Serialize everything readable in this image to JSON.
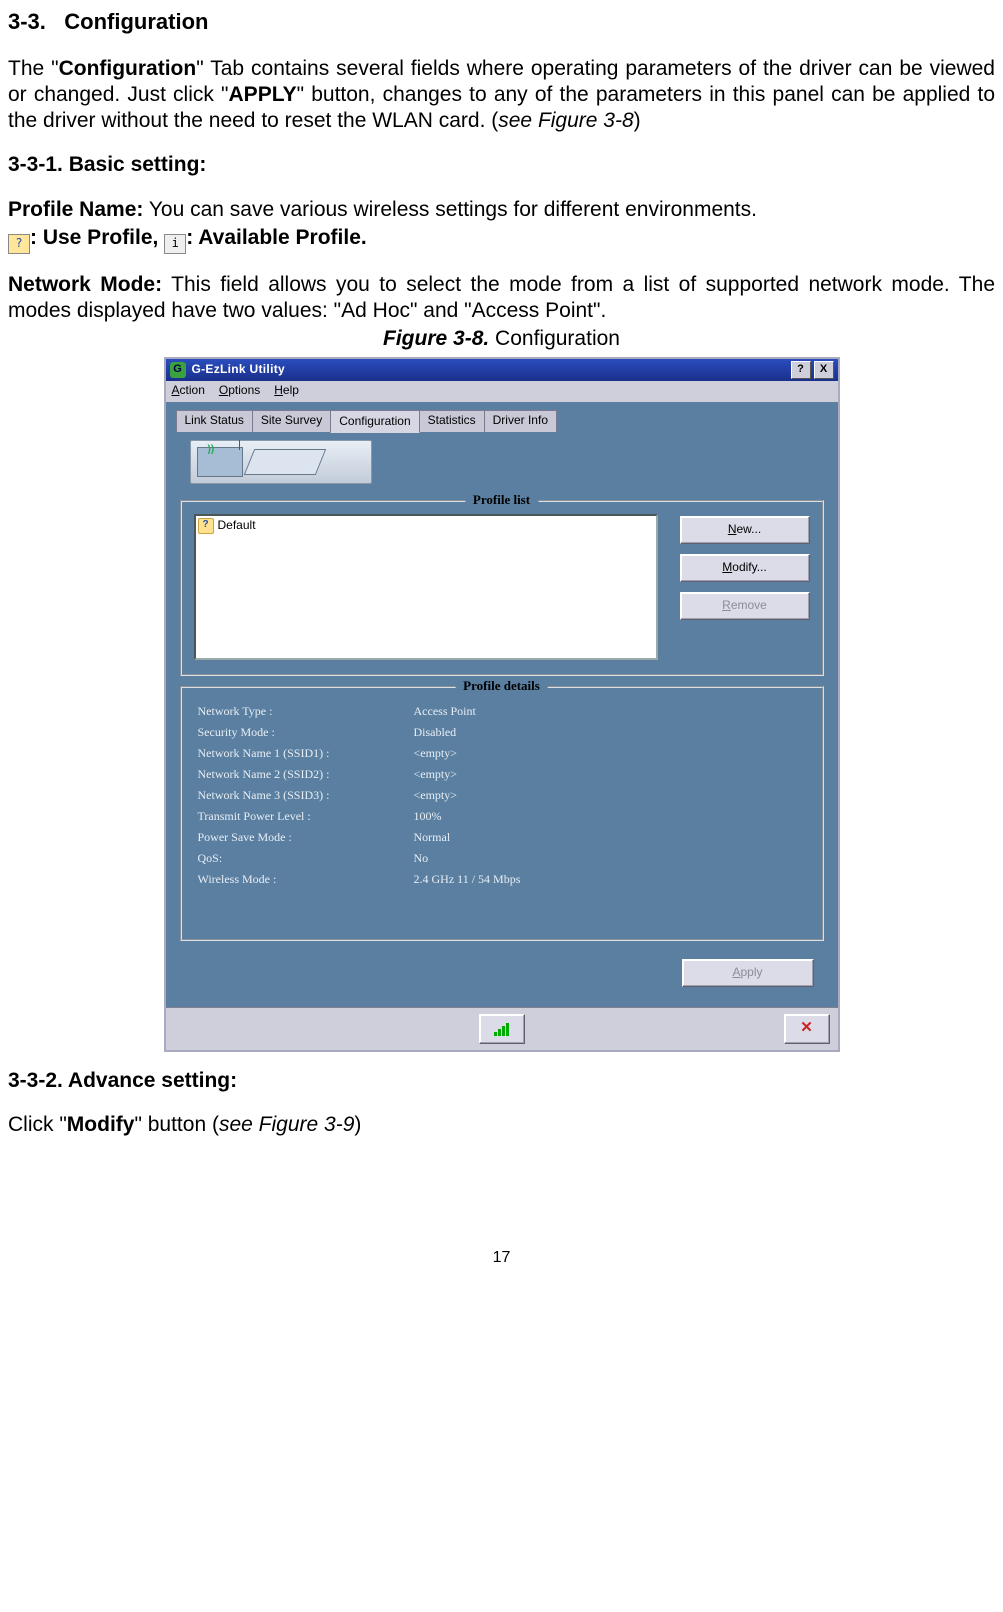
{
  "doc": {
    "section_no": "3-3.",
    "section_title": "Configuration",
    "p1_a": "The \"",
    "p1_b": "Configuration",
    "p1_c": "\" Tab contains several fields where operating parameters of the driver can be viewed or changed. Just click \"",
    "p1_d": "APPLY",
    "p1_e": "\" button, changes to any of the parameters in this panel can be applied to the driver without the need to reset the WLAN card. (",
    "p1_f": "see Figure 3-8",
    "p1_g": ")",
    "h331": "3-3-1. Basic setting:",
    "pn_label": "Profile Name:",
    "pn_text": " You can save various wireless settings for different environments.",
    "pn_use": ": Use Profile, ",
    "pn_avail": ": Available Profile.",
    "nm_label": "Network Mode:",
    "nm_text": " This field allows you to select the mode from a list of supported network mode. The modes displayed have two values: \"Ad Hoc\" and \"Access Point\".",
    "fig_label": "Figure 3-8.",
    "fig_text": "   Configuration",
    "h332": "3-3-2. Advance setting:",
    "p2_a": "Click \"",
    "p2_b": "Modify",
    "p2_c": "\" button (",
    "p2_d": "see Figure 3-9",
    "p2_e": ")",
    "page_num": "17"
  },
  "app": {
    "title": "G-EzLink Utility",
    "help_glyph": "?",
    "close_glyph": "X",
    "menu": {
      "action": "Action",
      "options": "Options",
      "help": "Help"
    },
    "tabs": {
      "link_status": "Link Status",
      "site_survey": "Site Survey",
      "configuration": "Configuration",
      "statistics": "Statistics",
      "driver_info": "Driver Info"
    },
    "profile_list_title": "Profile list",
    "profile_item": "Default",
    "btn_new": "New...",
    "btn_modify": "Modify...",
    "btn_remove": "Remove",
    "profile_details_title": "Profile details",
    "details": {
      "network_type_l": "Network Type :",
      "network_type_v": "Access Point",
      "security_mode_l": "Security Mode :",
      "security_mode_v": "Disabled",
      "ssid1_l": "Network Name 1 (SSID1) :",
      "ssid1_v": "<empty>",
      "ssid2_l": "Network Name 2 (SSID2) :",
      "ssid2_v": "<empty>",
      "ssid3_l": "Network Name 3 (SSID3) :",
      "ssid3_v": "<empty>",
      "txpower_l": "Transmit Power Level :",
      "txpower_v": "100%",
      "psave_l": "Power Save Mode :",
      "psave_v": "Normal",
      "qos_l": "QoS:",
      "qos_v": "No",
      "wmode_l": "Wireless Mode :",
      "wmode_v": " 2.4 GHz  11 / 54 Mbps"
    },
    "apply": "Apply",
    "close_x": "✕"
  }
}
